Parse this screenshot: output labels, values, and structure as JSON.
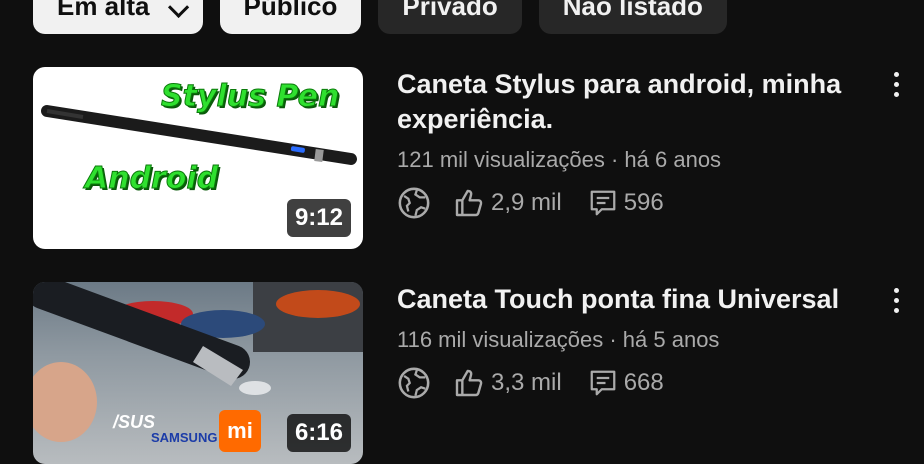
{
  "filters": [
    {
      "label": "Em alta",
      "active": true
    },
    {
      "label": "Público",
      "active": false
    },
    {
      "label": "Privado",
      "active": false
    },
    {
      "label": "Não listado",
      "active": false
    }
  ],
  "videos": [
    {
      "title": "Caneta Stylus para android, minha experiência.",
      "meta": "121 mil visualizações · há 6 anos",
      "likes": "2,9 mil",
      "comments": "596",
      "duration": "9:12",
      "thumb_text_1": "Stylus Pen",
      "thumb_text_2": "Android"
    },
    {
      "title": "Caneta Touch ponta fina Universal",
      "meta": "116 mil visualizações · há 5 anos",
      "likes": "3,3 mil",
      "comments": "668",
      "duration": "6:16",
      "thumb_logo_1": "/SUS",
      "thumb_logo_2": "SAMSUNG",
      "thumb_logo_3": "mi"
    }
  ]
}
